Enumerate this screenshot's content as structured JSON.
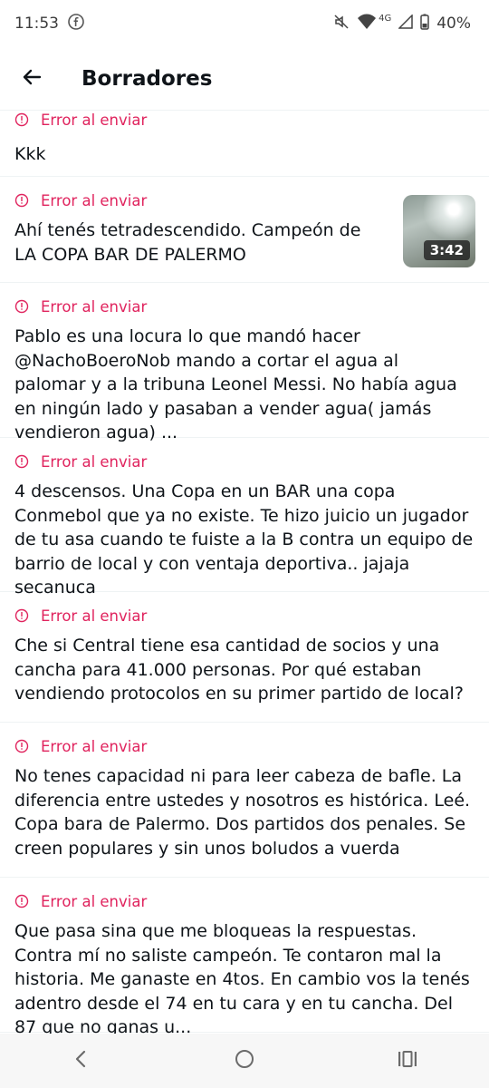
{
  "status_bar": {
    "time": "11:53",
    "network": "4G",
    "battery": "40%",
    "icons": [
      "facebook-icon",
      "mute-icon",
      "wifi-icon",
      "signal-icon",
      "battery-icon"
    ]
  },
  "header": {
    "title": "Borradores",
    "back_icon": "arrow-left-icon"
  },
  "drafts": [
    {
      "error": "Error al enviar",
      "text": "Kkk"
    },
    {
      "error": "Error al enviar",
      "text": "Ahí tenés tetradescendido. Campeón de LA COPA BAR DE PALERMO",
      "media_duration": "3:42"
    },
    {
      "error": "Error al enviar",
      "text": "Pablo es una locura lo que mandó hacer @NachoBoeroNob  mando a cortar el agua al palomar y a la tribuna Leonel Messi. No había agua en ningún lado y pasaban a vender agua( jamás vendieron agua) ..."
    },
    {
      "error": "Error al enviar",
      "text": "4 descensos. Una Copa en un BAR una copa Conmebol que ya no existe. Te hizo juicio un jugador de tu asa cuando te fuiste a la B contra un equipo de barrio de local y con ventaja deportiva.. jajaja secanuca"
    },
    {
      "error": "Error al enviar",
      "text": "Che si Central tiene esa cantidad de socios y una cancha para 41.000 personas. Por qué estaban vendiendo protocolos en su primer partido de local?"
    },
    {
      "error": "Error al enviar",
      "text": "No tenes capacidad ni para leer cabeza de bafle. La diferencia entre ustedes y nosotros es histórica. Leé. Copa bara de Palermo. Dos partidos dos penales. Se creen populares y sin unos boludos a vuerda"
    },
    {
      "error": "Error al enviar",
      "text": "Que pasa sina que me bloqueas la respuestas. Contra mí no saliste campeón. Te contaron mal la historia. Me ganaste en 4tos. En cambio vos la tenés adentro desde el 74 en tu cara y en tu cancha. Del 87 que no ganas u..."
    }
  ],
  "colors": {
    "error": "#e0245e",
    "text": "#0f1419",
    "divider": "#eff3f4"
  },
  "nav_bar": {
    "icons": [
      "back-nav-icon",
      "home-nav-icon",
      "recents-nav-icon"
    ]
  }
}
